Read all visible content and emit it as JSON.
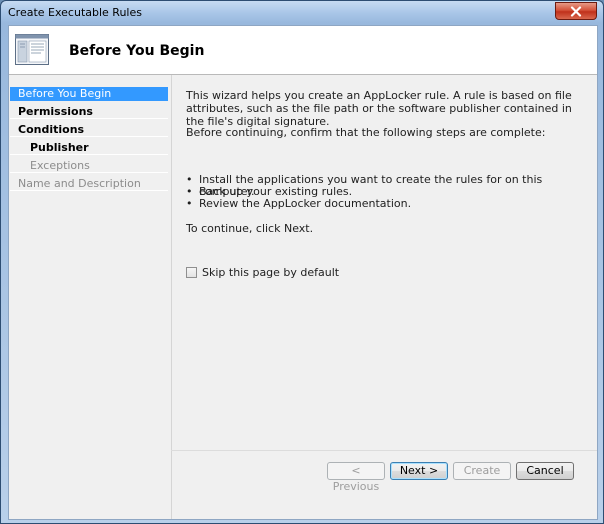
{
  "window": {
    "title": "Create Executable Rules"
  },
  "header": {
    "title": "Before You Begin",
    "icon": "wizard-page-icon"
  },
  "sidebar": {
    "items": [
      {
        "label": "Before You Begin",
        "state": "active",
        "indent": false
      },
      {
        "label": "Permissions",
        "state": "bold",
        "indent": false
      },
      {
        "label": "Conditions",
        "state": "bold",
        "indent": false
      },
      {
        "label": "Publisher",
        "state": "bold",
        "indent": true
      },
      {
        "label": "Exceptions",
        "state": "disabled",
        "indent": true
      },
      {
        "label": "Name and Description",
        "state": "disabled",
        "indent": false
      }
    ]
  },
  "content": {
    "intro": "This wizard helps you create an AppLocker rule. A rule is based on file attributes, such as the file path or the software publisher contained in the file's digital signature.",
    "confirm": "Before continuing, confirm that the following steps are complete:",
    "steps": [
      "Install the applications you want to create the rules for on this computer.",
      "Back up your existing rules.",
      "Review the AppLocker documentation."
    ],
    "continue": "To continue, click Next.",
    "skip_label": "Skip this page by default",
    "skip_checked": false
  },
  "buttons": {
    "previous": "< Previous",
    "next": "Next >",
    "create": "Create",
    "cancel": "Cancel"
  },
  "colors": {
    "active_step_bg": "#3399ff",
    "close_button": "#c0311b",
    "disabled_text": "#8c8c8c"
  }
}
